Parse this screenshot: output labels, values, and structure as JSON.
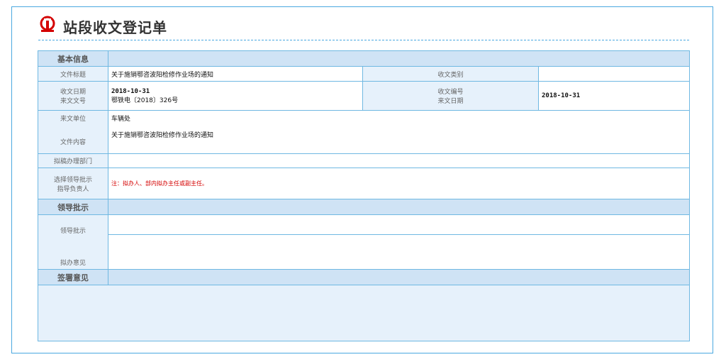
{
  "title": "站段收文登记单",
  "sections": {
    "basic_info": "基本信息",
    "leader_instructions": "领导批示",
    "sign_opinion": "签署意见"
  },
  "fields": {
    "doc_title_label": "文件标题",
    "doc_title_value": "关于施销鄂咨波阳检修作业场的通知",
    "doc_category_label": "收文类别",
    "doc_category_value": "",
    "receive_date_label": "收文日期",
    "receive_date_value": "2018-10-31",
    "receive_number_label": "收文编号",
    "receive_number_value": "",
    "doc_ref_label": "来文文号",
    "doc_ref_value": "鄂铁电〔2018〕326号",
    "doc_date_label": "来文日期",
    "doc_date_value": "2018-10-31",
    "sender_label": "来文单位",
    "sender_value": "车辆处",
    "content_label": "文件内容",
    "content_value": "关于施销鄂咨波阳检修作业场的通知",
    "process_dept_label": "拟稿办理部门",
    "choose_leader_label": "选择领导批示",
    "designated_handler_label": "指导负责人",
    "note_text": "注：拟办人、部内拟办主任或副主任。",
    "leader_instr_label": "领导批示",
    "handling_opinion_label": "拟办意见"
  },
  "colors": {
    "border": "#6fb8e2",
    "section_bg": "#cfe3f5",
    "label_bg": "#e6f1fb",
    "note": "#d40000",
    "logo": "#d40000"
  },
  "icons": {
    "logo": "railway-logo-icon"
  }
}
